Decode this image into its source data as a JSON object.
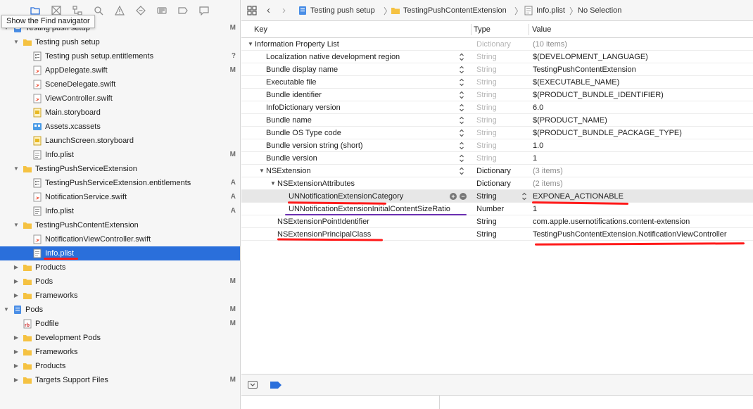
{
  "colors": {
    "selection": "#2a6fdb",
    "annotation_red": "#ff1a1a",
    "annotation_purple": "#6a2fb0",
    "folder": "#f5c242"
  },
  "navigator": {
    "toolbar_icons": [
      "folder-icon",
      "source-control-icon",
      "symbol-icon",
      "find-icon",
      "issue-icon",
      "test-icon",
      "debug-icon",
      "breakpoint-icon",
      "report-icon"
    ],
    "tooltip": "Show the Find navigator",
    "items": [
      {
        "label": "Testing push setup",
        "badge": "M",
        "icon": "project-icon",
        "level": 0,
        "disclosure": "open"
      },
      {
        "label": "Testing push setup",
        "badge": "",
        "icon": "folder-icon",
        "level": 1,
        "disclosure": "open"
      },
      {
        "label": "Testing push setup.entitlements",
        "badge": "?",
        "icon": "entitlements-icon",
        "level": 2,
        "disclosure": ""
      },
      {
        "label": "AppDelegate.swift",
        "badge": "M",
        "icon": "swift-file-icon",
        "level": 2,
        "disclosure": ""
      },
      {
        "label": "SceneDelegate.swift",
        "badge": "",
        "icon": "swift-file-icon",
        "level": 2,
        "disclosure": ""
      },
      {
        "label": "ViewController.swift",
        "badge": "",
        "icon": "swift-file-icon",
        "level": 2,
        "disclosure": ""
      },
      {
        "label": "Main.storyboard",
        "badge": "",
        "icon": "storyboard-icon",
        "level": 2,
        "disclosure": ""
      },
      {
        "label": "Assets.xcassets",
        "badge": "",
        "icon": "assets-icon",
        "level": 2,
        "disclosure": ""
      },
      {
        "label": "LaunchScreen.storyboard",
        "badge": "",
        "icon": "storyboard-icon",
        "level": 2,
        "disclosure": ""
      },
      {
        "label": "Info.plist",
        "badge": "M",
        "icon": "plist-icon",
        "level": 2,
        "disclosure": ""
      },
      {
        "label": "TestingPushServiceExtension",
        "badge": "",
        "icon": "folder-icon",
        "level": 1,
        "disclosure": "open"
      },
      {
        "label": "TestingPushServiceExtension.entitlements",
        "badge": "A",
        "icon": "entitlements-icon",
        "level": 2,
        "disclosure": ""
      },
      {
        "label": "NotificationService.swift",
        "badge": "A",
        "icon": "swift-file-icon",
        "level": 2,
        "disclosure": ""
      },
      {
        "label": "Info.plist",
        "badge": "A",
        "icon": "plist-icon",
        "level": 2,
        "disclosure": ""
      },
      {
        "label": "TestingPushContentExtension",
        "badge": "",
        "icon": "folder-icon",
        "level": 1,
        "disclosure": "open"
      },
      {
        "label": "NotificationViewController.swift",
        "badge": "",
        "icon": "swift-file-icon",
        "level": 2,
        "disclosure": ""
      },
      {
        "label": "Info.plist",
        "badge": "",
        "icon": "plist-icon",
        "level": 2,
        "disclosure": "",
        "selected": true
      },
      {
        "label": "Products",
        "badge": "",
        "icon": "folder-icon",
        "level": 1,
        "disclosure": "closed"
      },
      {
        "label": "Pods",
        "badge": "M",
        "icon": "folder-icon",
        "level": 1,
        "disclosure": "closed"
      },
      {
        "label": "Frameworks",
        "badge": "",
        "icon": "folder-icon",
        "level": 1,
        "disclosure": "closed"
      },
      {
        "label": "Pods",
        "badge": "M",
        "icon": "project-icon",
        "level": 0,
        "disclosure": "open"
      },
      {
        "label": "Podfile",
        "badge": "M",
        "icon": "ruby-file-icon",
        "level": 1,
        "disclosure": ""
      },
      {
        "label": "Development Pods",
        "badge": "",
        "icon": "folder-icon",
        "level": 1,
        "disclosure": "closed"
      },
      {
        "label": "Frameworks",
        "badge": "",
        "icon": "folder-icon",
        "level": 1,
        "disclosure": "closed"
      },
      {
        "label": "Products",
        "badge": "",
        "icon": "folder-icon",
        "level": 1,
        "disclosure": "closed"
      },
      {
        "label": "Targets Support Files",
        "badge": "M",
        "icon": "folder-icon",
        "level": 1,
        "disclosure": "closed"
      }
    ]
  },
  "jumpbar": {
    "crumbs": [
      "Testing push setup",
      "TestingPushContentExtension",
      "Info.plist",
      "No Selection"
    ]
  },
  "plist": {
    "columns": {
      "key": "Key",
      "type": "Type",
      "value": "Value"
    },
    "rows": [
      {
        "key": "Information Property List",
        "type": "Dictionary",
        "value": "(10 items)",
        "level": 0,
        "disclosure": "open",
        "muted_type": true,
        "muted_value": true,
        "stepper": false
      },
      {
        "key": "Localization native development region",
        "type": "String",
        "value": "$(DEVELOPMENT_LANGUAGE)",
        "level": 1,
        "disclosure": "",
        "muted_type": true,
        "stepper": true
      },
      {
        "key": "Bundle display name",
        "type": "String",
        "value": "TestingPushContentExtension",
        "level": 1,
        "disclosure": "",
        "muted_type": true,
        "stepper": true
      },
      {
        "key": "Executable file",
        "type": "String",
        "value": "$(EXECUTABLE_NAME)",
        "level": 1,
        "disclosure": "",
        "muted_type": true,
        "stepper": true
      },
      {
        "key": "Bundle identifier",
        "type": "String",
        "value": "$(PRODUCT_BUNDLE_IDENTIFIER)",
        "level": 1,
        "disclosure": "",
        "muted_type": true,
        "stepper": true
      },
      {
        "key": "InfoDictionary version",
        "type": "String",
        "value": "6.0",
        "level": 1,
        "disclosure": "",
        "muted_type": true,
        "stepper": true
      },
      {
        "key": "Bundle name",
        "type": "String",
        "value": "$(PRODUCT_NAME)",
        "level": 1,
        "disclosure": "",
        "muted_type": true,
        "stepper": true
      },
      {
        "key": "Bundle OS Type code",
        "type": "String",
        "value": "$(PRODUCT_BUNDLE_PACKAGE_TYPE)",
        "level": 1,
        "disclosure": "",
        "muted_type": true,
        "stepper": true
      },
      {
        "key": "Bundle version string (short)",
        "type": "String",
        "value": "1.0",
        "level": 1,
        "disclosure": "",
        "muted_type": true,
        "stepper": true
      },
      {
        "key": "Bundle version",
        "type": "String",
        "value": "1",
        "level": 1,
        "disclosure": "",
        "muted_type": true,
        "stepper": true
      },
      {
        "key": "NSExtension",
        "type": "Dictionary",
        "value": "(3 items)",
        "level": 1,
        "disclosure": "open",
        "muted_value": true,
        "stepper": true
      },
      {
        "key": "NSExtensionAttributes",
        "type": "Dictionary",
        "value": "(2 items)",
        "level": 2,
        "disclosure": "open",
        "muted_value": true,
        "stepper": false
      },
      {
        "key": "UNNotificationExtensionCategory",
        "type": "String",
        "value": "EXPONEA_ACTIONABLE",
        "level": 3,
        "disclosure": "",
        "highlighted": true,
        "addremove": true,
        "type_stepper": true
      },
      {
        "key": "UNNotificationExtensionInitialContentSizeRatio",
        "type": "Number",
        "value": "1",
        "level": 3,
        "disclosure": ""
      },
      {
        "key": "NSExtensionPointIdentifier",
        "type": "String",
        "value": "com.apple.usernotifications.content-extension",
        "level": 2,
        "disclosure": ""
      },
      {
        "key": "NSExtensionPrincipalClass",
        "type": "String",
        "value": "TestingPushContentExtension.NotificationViewController",
        "level": 2,
        "disclosure": ""
      }
    ]
  }
}
